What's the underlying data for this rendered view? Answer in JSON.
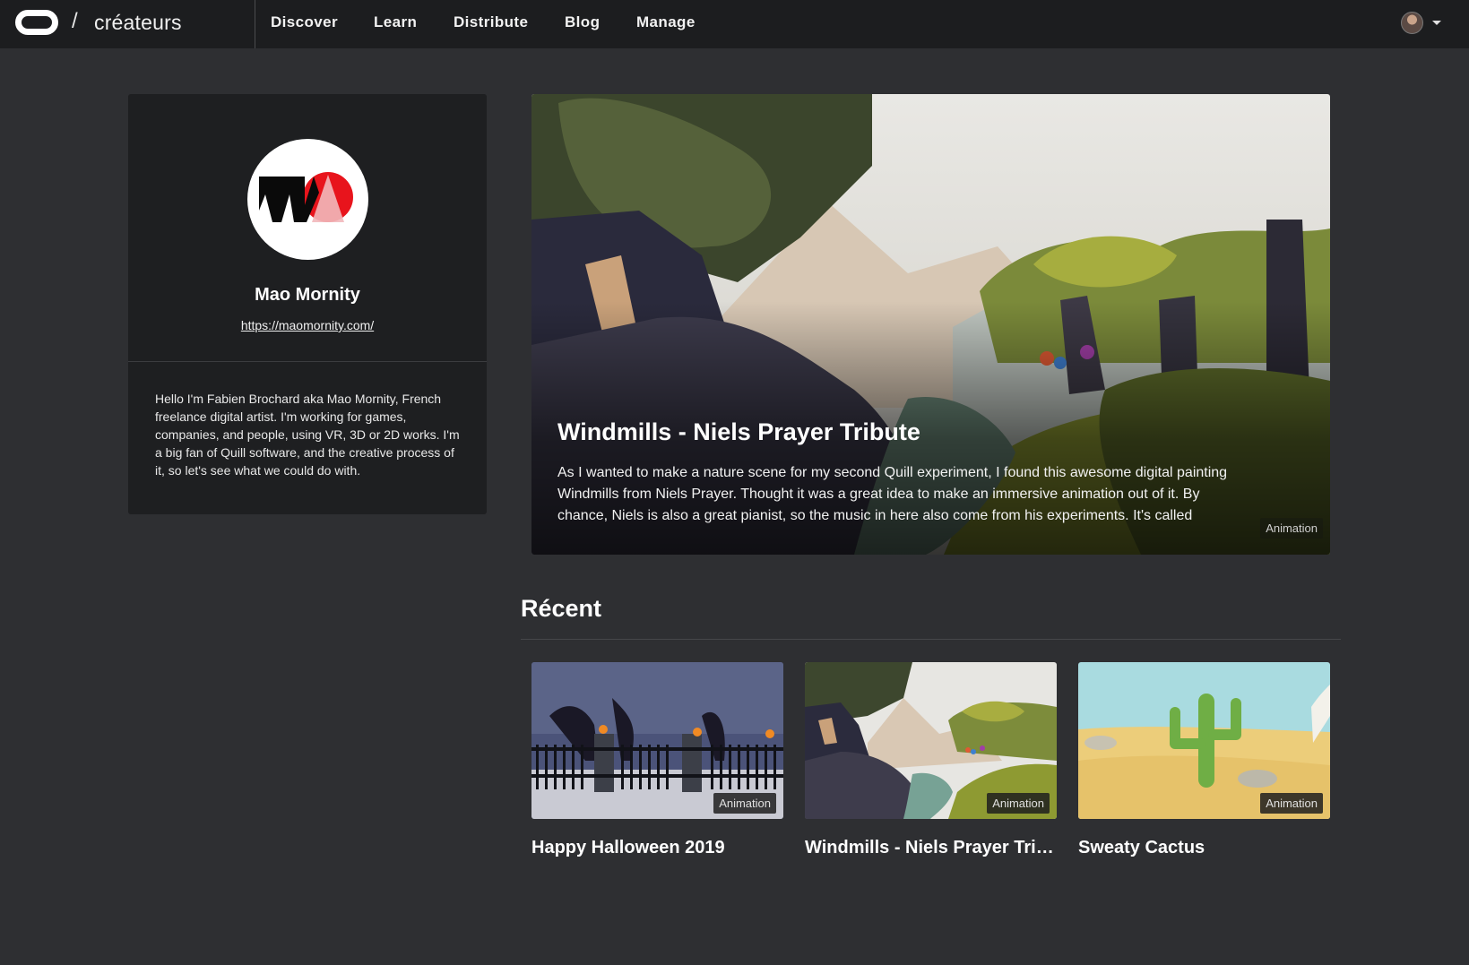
{
  "nav": {
    "brand_slash": "/",
    "brand_name": "créateurs",
    "links": [
      "Discover",
      "Learn",
      "Distribute",
      "Blog",
      "Manage"
    ]
  },
  "profile": {
    "name": "Mao Mornity",
    "url": "https://maomornity.com/",
    "bio": "Hello I'm Fabien Brochard aka Mao Mornity, French freelance digital artist. I'm working for games, companies, and people, using VR, 3D or 2D works. I'm a big fan of Quill software, and the creative process of it, so let's see what we could do with."
  },
  "featured": {
    "title": "Windmills - Niels Prayer Tribute",
    "description": "As I wanted to make a nature scene for my second Quill experiment, I found this awesome digital painting Windmills from Niels Prayer. Thought it was a great idea to make an immersive animation out of it. By chance, Niels is also a great pianist, so the music in here also come from his experiments. It's called Phosphene.",
    "tag": "Animation"
  },
  "recent": {
    "heading": "Récent",
    "cards": [
      {
        "title": "Happy Halloween 2019",
        "tag": "Animation"
      },
      {
        "title": "Windmills - Niels Prayer Tribute",
        "tag": "Animation"
      },
      {
        "title": "Sweaty Cactus",
        "tag": "Animation"
      }
    ]
  },
  "icons": {
    "brand": "oculus-logo-icon",
    "account": "user-avatar-icon",
    "account_menu": "caret-down-icon"
  },
  "colors": {
    "page_bg": "#2e2f32",
    "topbar_bg": "#1c1d1f",
    "card_bg": "#1e1f21",
    "text": "#ffffff"
  }
}
